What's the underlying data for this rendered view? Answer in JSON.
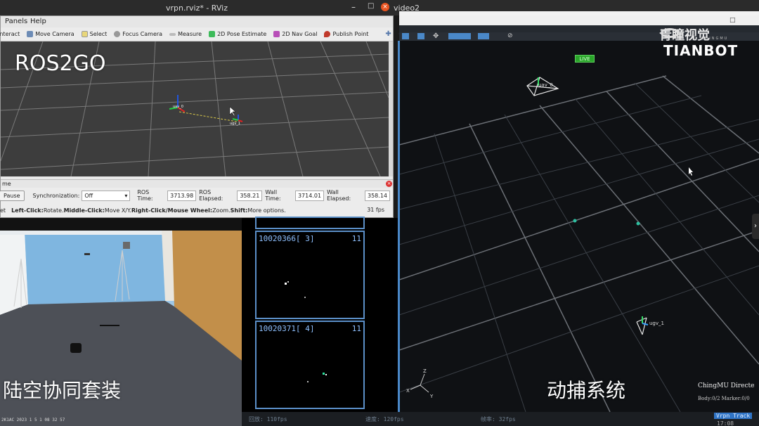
{
  "os_bar": {
    "window_title": "vrpn.rviz* - RViz",
    "video_title": "video2"
  },
  "rviz": {
    "menu": [
      "Panels",
      "Help"
    ],
    "tools": [
      {
        "label": "Interact",
        "icon": "interact-icon"
      },
      {
        "label": "Move Camera",
        "icon": "move-camera-icon"
      },
      {
        "label": "Select",
        "icon": "select-icon"
      },
      {
        "label": "Focus Camera",
        "icon": "focus-camera-icon"
      },
      {
        "label": "Measure",
        "icon": "measure-icon"
      },
      {
        "label": "2D Pose Estimate",
        "icon": "pose-estimate-icon"
      },
      {
        "label": "2D Nav Goal",
        "icon": "nav-goal-icon"
      },
      {
        "label": "Publish Point",
        "icon": "publish-point-icon"
      }
    ],
    "overlay_text": "ROS2GO",
    "frame_labels": [
      "uav_0",
      "ugv_1"
    ],
    "time_panel": {
      "title": "me",
      "pause_label": "Pause",
      "sync_label": "Synchronization:",
      "sync_value": "Off",
      "ros_time_label": "ROS Time:",
      "ros_time_value": "3713.98",
      "ros_elapsed_label": "ROS Elapsed:",
      "ros_elapsed_value": "358.21",
      "wall_time_label": "Wall Time:",
      "wall_time_value": "3714.01",
      "wall_elapsed_label": "Wall Elapsed:",
      "wall_elapsed_value": "358.14"
    },
    "hint": {
      "prefix": "et",
      "l1": "Left-Click:",
      "t1": " Rotate. ",
      "l2": "Middle-Click:",
      "t2": " Move X/Y. ",
      "l3": "Right-Click/Mouse Wheel:",
      "t3": " Zoom. ",
      "l4": "Shift:",
      "t4": " More options.",
      "fps": "31 fps"
    }
  },
  "photo": {
    "caption": "陆空协同套装",
    "timestamp": "2K1AC 2023 1 5 1 08 32 57"
  },
  "cameras": [
    {
      "id": "10020366",
      "num": "[  3]",
      "idx": "11"
    },
    {
      "id": "10020371",
      "num": "[  4]",
      "idx": "11"
    }
  ],
  "mocap": {
    "live_badge": "LIVE",
    "objects": [
      "uav_0",
      "ugv_1"
    ],
    "caption": "动捕系统",
    "brand": "ChingMU Directe",
    "brand_sub": "Body:0/2 Marker:0/0",
    "logo_cn": "青瞳视觉",
    "logo_en_small": "CHINGMU",
    "logo_en": "TIANBOT",
    "axes": [
      "Z",
      "X",
      "Y"
    ]
  },
  "statusbar": {
    "items": [
      "回放: 110fps",
      "速度: 120fps",
      "帧率: 32fps",
      "Vrpn Track"
    ],
    "clock": "17:08"
  },
  "colors": {
    "mocap_grid": "#8a8f96",
    "cam_border": "#5b8fc8",
    "live": "#2aa52a"
  }
}
